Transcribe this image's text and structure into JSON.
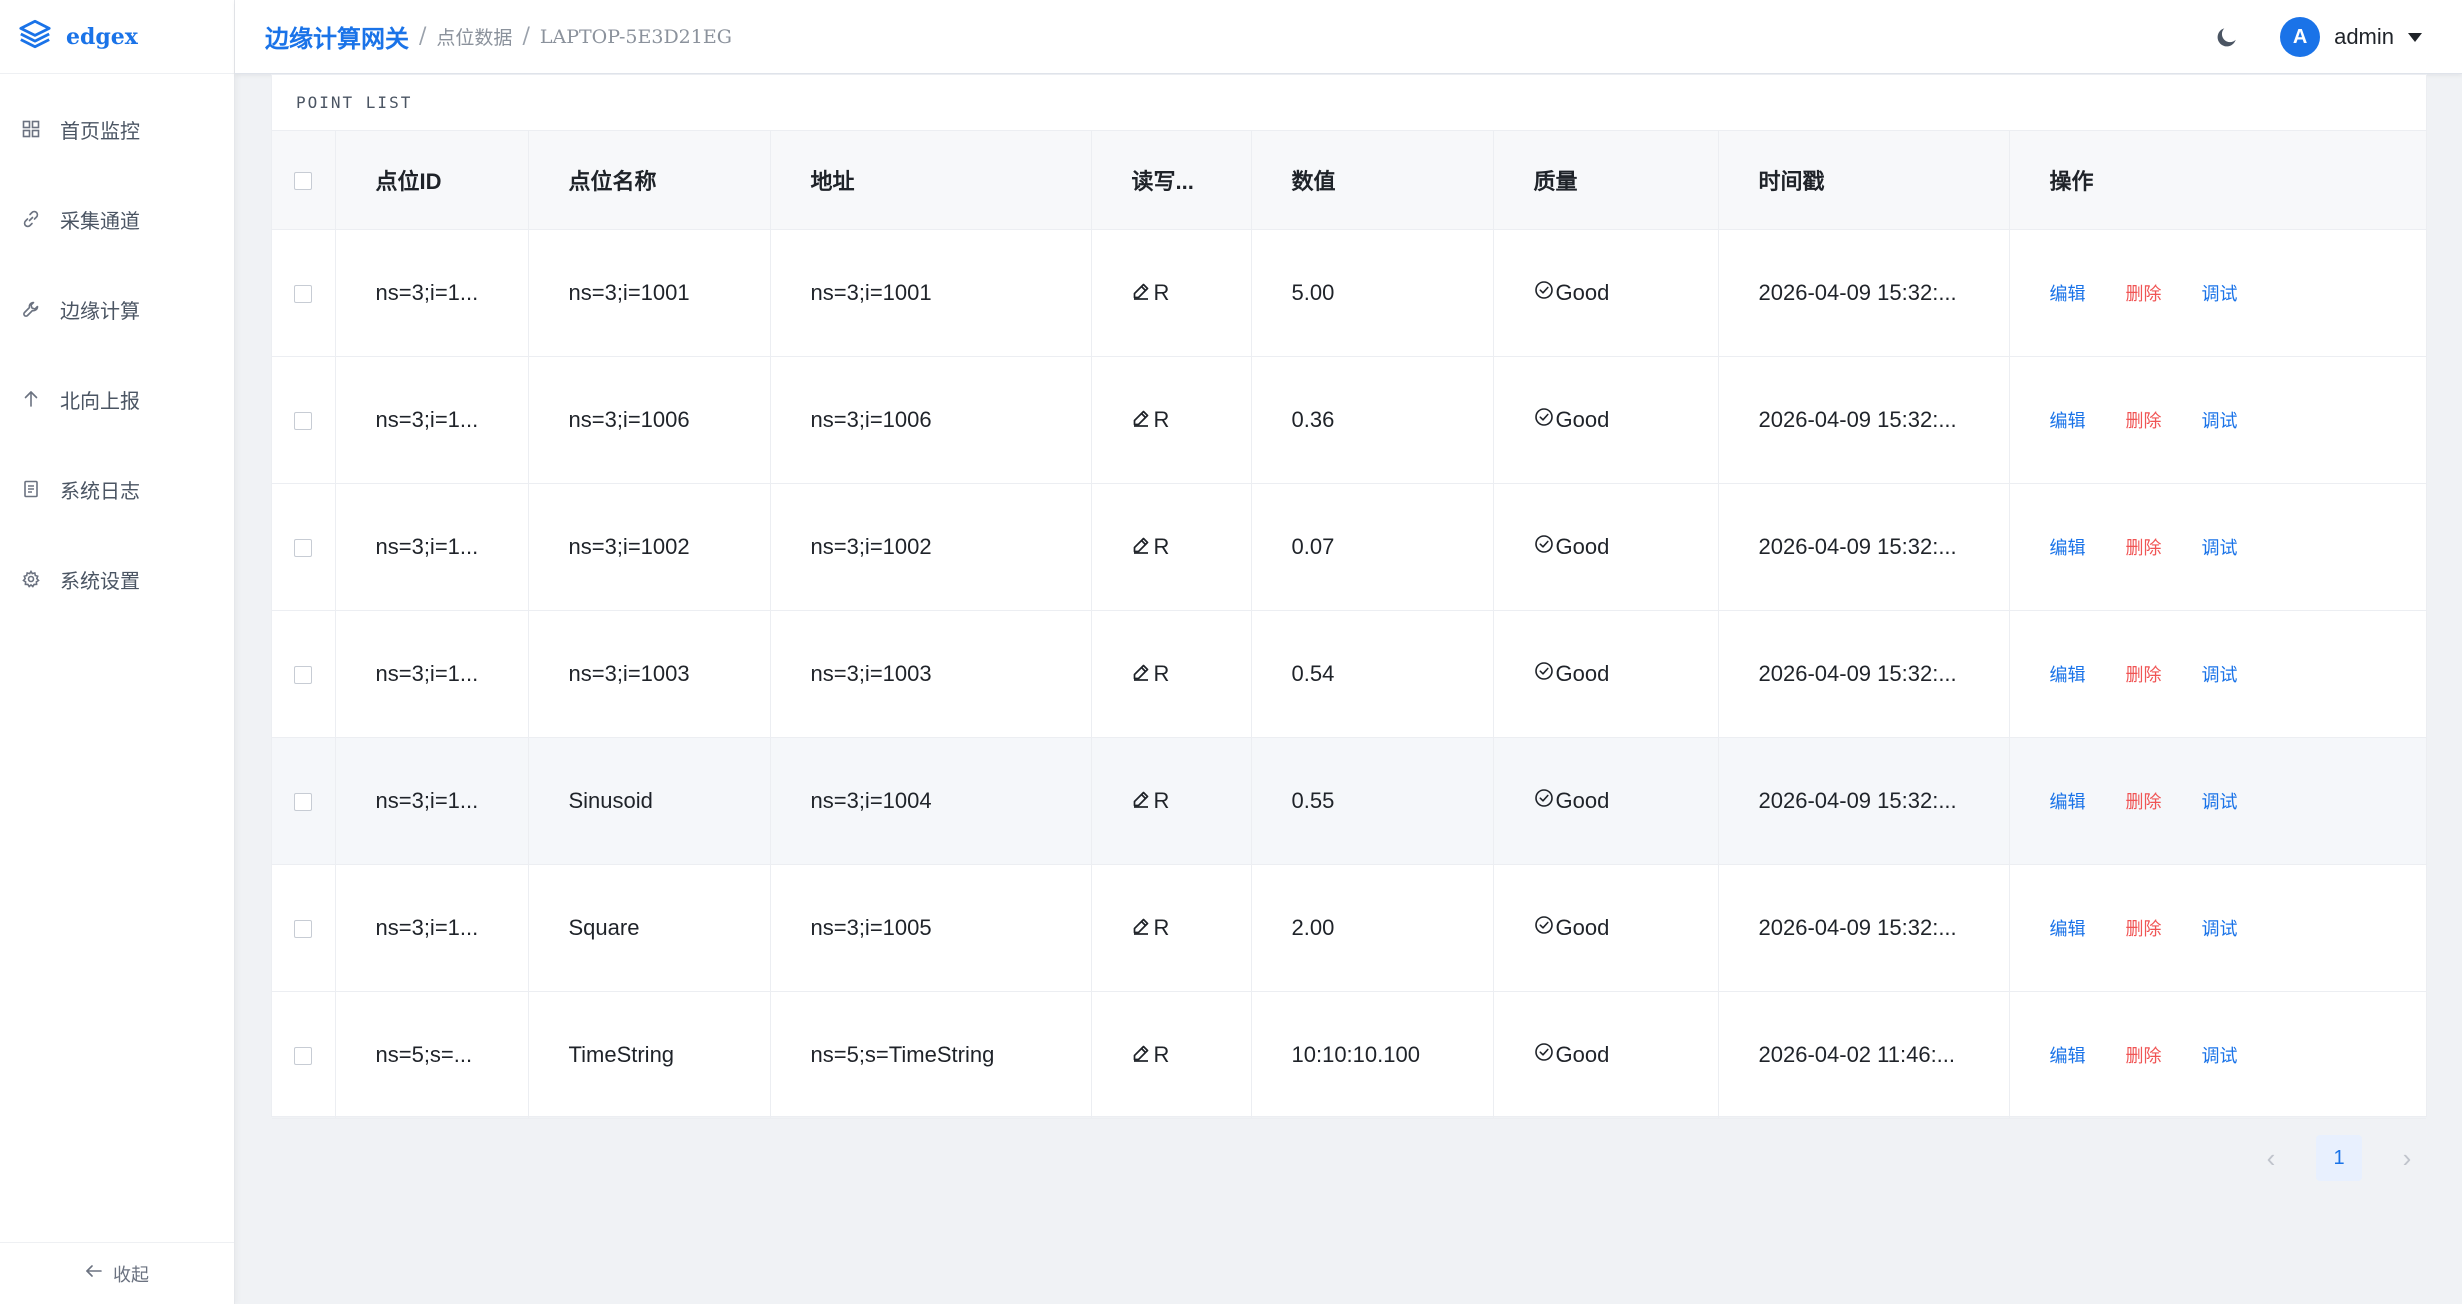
{
  "app": {
    "name": "edgex"
  },
  "sidebar": {
    "items": [
      {
        "label": "首页监控",
        "icon": "grid-icon"
      },
      {
        "label": "采集通道",
        "icon": "link-icon"
      },
      {
        "label": "边缘计算",
        "icon": "wrench-icon"
      },
      {
        "label": "北向上报",
        "icon": "arrow-up-icon"
      },
      {
        "label": "系统日志",
        "icon": "document-icon"
      },
      {
        "label": "系统设置",
        "icon": "gear-icon"
      }
    ],
    "collapse_label": "收起"
  },
  "header": {
    "breadcrumb": [
      "边缘计算网关",
      "点位数据",
      "LAPTOP-5E3D21EG"
    ],
    "user": {
      "avatar_letter": "A",
      "name": "admin"
    }
  },
  "panel": {
    "title": "POINT LIST"
  },
  "table": {
    "headers": [
      "点位ID",
      "点位名称",
      "地址",
      "读写...",
      "数值",
      "质量",
      "时间戳",
      "操作"
    ],
    "rows": [
      {
        "id": "ns=3;i=1...",
        "name": "ns=3;i=1001",
        "address": "ns=3;i=1001",
        "rw": "R",
        "value": "5.00",
        "quality": "Good",
        "timestamp": "2026-04-09 15:32:..."
      },
      {
        "id": "ns=3;i=1...",
        "name": "ns=3;i=1006",
        "address": "ns=3;i=1006",
        "rw": "R",
        "value": "0.36",
        "quality": "Good",
        "timestamp": "2026-04-09 15:32:..."
      },
      {
        "id": "ns=3;i=1...",
        "name": "ns=3;i=1002",
        "address": "ns=3;i=1002",
        "rw": "R",
        "value": "0.07",
        "quality": "Good",
        "timestamp": "2026-04-09 15:32:..."
      },
      {
        "id": "ns=3;i=1...",
        "name": "ns=3;i=1003",
        "address": "ns=3;i=1003",
        "rw": "R",
        "value": "0.54",
        "quality": "Good",
        "timestamp": "2026-04-09 15:32:..."
      },
      {
        "id": "ns=3;i=1...",
        "name": "Sinusoid",
        "address": "ns=3;i=1004",
        "rw": "R",
        "value": "0.55",
        "quality": "Good",
        "timestamp": "2026-04-09 15:32:..."
      },
      {
        "id": "ns=3;i=1...",
        "name": "Square",
        "address": "ns=3;i=1005",
        "rw": "R",
        "value": "2.00",
        "quality": "Good",
        "timestamp": "2026-04-09 15:32:..."
      },
      {
        "id": "ns=5;s=...",
        "name": "TimeString",
        "address": "ns=5;s=TimeString",
        "rw": "R",
        "value": "10:10:10.100",
        "quality": "Good",
        "timestamp": "2026-04-02 11:46:..."
      }
    ],
    "actions": {
      "edit": "编辑",
      "delete": "删除",
      "debug": "调试"
    }
  },
  "pagination": {
    "current": "1"
  },
  "colors": {
    "accent": "#1a73e8",
    "danger": "#f05454",
    "row_highlight": "#f5f7fa"
  }
}
